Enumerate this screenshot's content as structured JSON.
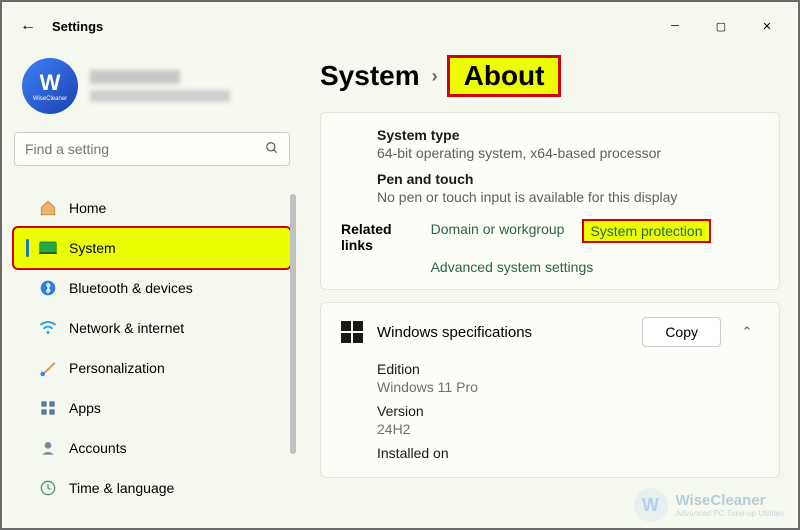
{
  "titlebar": {
    "title": "Settings"
  },
  "profile": {
    "avatar_letter": "W",
    "avatar_sub": "WiseCleaner"
  },
  "search": {
    "placeholder": "Find a setting"
  },
  "nav": [
    {
      "label": "Home"
    },
    {
      "label": "System"
    },
    {
      "label": "Bluetooth & devices"
    },
    {
      "label": "Network & internet"
    },
    {
      "label": "Personalization"
    },
    {
      "label": "Apps"
    },
    {
      "label": "Accounts"
    },
    {
      "label": "Time & language"
    }
  ],
  "breadcrumb": {
    "root": "System",
    "current": "About"
  },
  "device": {
    "system_type_k": "System type",
    "system_type_v": "64-bit operating system, x64-based processor",
    "pen_k": "Pen and touch",
    "pen_v": "No pen or touch input is available for this display"
  },
  "related": {
    "label": "Related links",
    "domain": "Domain or workgroup",
    "protection": "System protection",
    "advanced": "Advanced system settings"
  },
  "specs": {
    "title": "Windows specifications",
    "copy": "Copy",
    "edition_k": "Edition",
    "edition_v": "Windows 11 Pro",
    "version_k": "Version",
    "version_v": "24H2",
    "installed_k": "Installed on"
  },
  "watermark": {
    "name": "WiseCleaner",
    "tag": "Advanced PC Tune-up Utilities"
  }
}
